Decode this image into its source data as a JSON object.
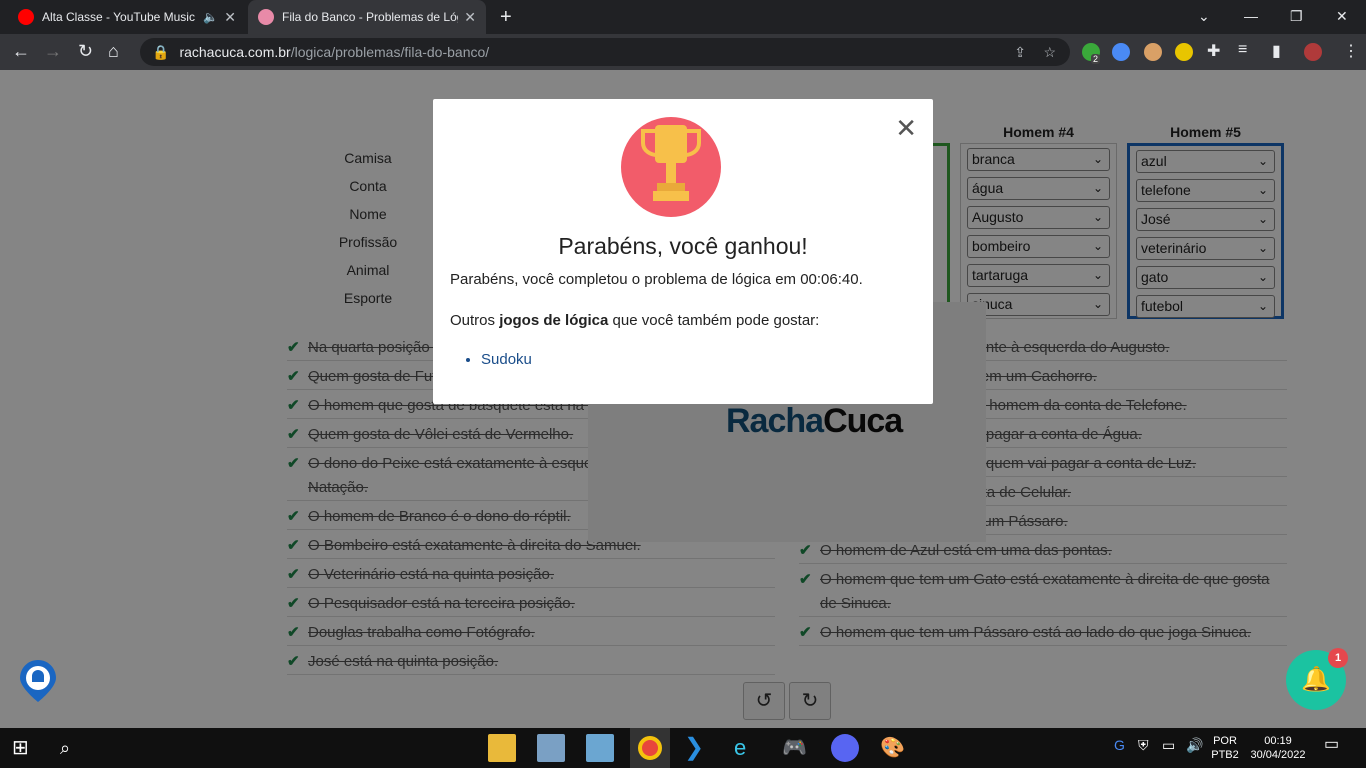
{
  "browser": {
    "tabs": [
      {
        "title": "Alta Classe - YouTube Music",
        "active": false,
        "icon": "youtube-music-icon"
      },
      {
        "title": "Fila do Banco - Problemas de Lógica",
        "active": true,
        "icon": "brain-icon"
      }
    ],
    "url_host": "rachacuca.com.br",
    "url_path": "/logica/problemas/fila-do-banco/"
  },
  "puzzle": {
    "row_labels": [
      "Camisa",
      "Conta",
      "Nome",
      "Profissão",
      "Animal",
      "Esporte"
    ],
    "columns": [
      {
        "header": "Homem #4",
        "values": [
          "branca",
          "água",
          "Augusto",
          "bombeiro",
          "tartaruga",
          "sinuca"
        ]
      },
      {
        "header": "Homem #5",
        "values": [
          "azul",
          "telefone",
          "José",
          "veterinário",
          "gato",
          "futebol"
        ]
      }
    ],
    "clues_left": [
      "Na quarta posição está quem gosta de Vôlei.",
      "Quem gosta de Futebol está em uma das pontas.",
      "O homem que gosta de basquete está na segunda posição.",
      "Quem gosta de Vôlei está de Vermelho.",
      "O dono do Peixe está exatamente à esquerda de quem pratica Natação.",
      "O homem de Branco é o dono do réptil.",
      "O Bombeiro está exatamente à direita do Samuel.",
      "O Veterinário está na quinta posição.",
      "O Pesquisador está na terceira posição.",
      "Douglas trabalha como Fotógrafo.",
      "José está na quinta posição."
    ],
    "clues_right": [
      "O Ronaldo está exatamente à esquerda do Augusto.",
      "Quem gosta de Sinuca tem um Cachorro.",
      "Na quinta posição está o homem da conta de Telefone.",
      "O homem de Branco vai pagar a conta de Água.",
      "Na terceira posição está quem vai pagar a conta de Luz.",
      "Ronaldo vai pagar a conta de Celular.",
      "O homem de Verde tem um Pássaro.",
      "O homem de Azul está em uma das pontas.",
      "O homem que tem um Gato está exatamente à direita de que gosta de Sinuca.",
      "O homem que tem um Pássaro está ao lado do que joga Sinuca."
    ],
    "logo_text_a": "Racha",
    "logo_text_b": "Cuca"
  },
  "modal": {
    "title": "Parabéns, você ganhou!",
    "message": "Parabéns, você completou o problema de lógica em 00:06:40.",
    "other_prefix": "Outros ",
    "other_bold": "jogos de lógica",
    "other_suffix": " que você também pode gostar:",
    "links": [
      "Sudoku"
    ]
  },
  "notifications": {
    "badge": "1"
  },
  "ext_badge": "2",
  "taskbar": {
    "lang_top": "POR",
    "lang_bottom": "PTB2",
    "time": "00:19",
    "date": "30/04/2022"
  }
}
